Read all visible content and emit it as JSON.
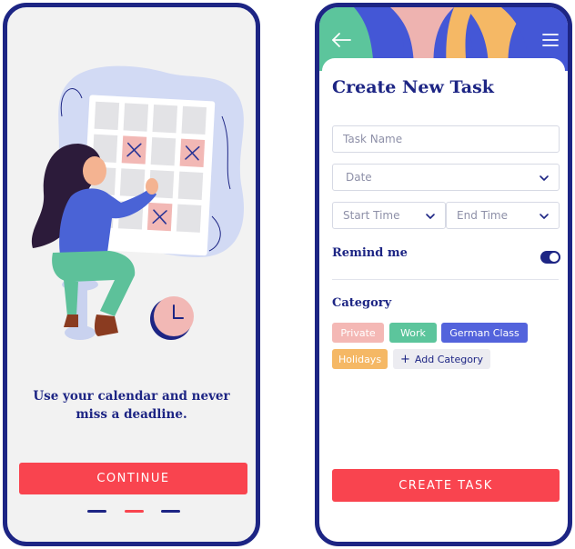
{
  "onboarding": {
    "line1": "Use your calendar and never",
    "line2": "miss a deadline.",
    "continue_label": "CONTINUE",
    "pages": {
      "current": 2,
      "total": 3
    },
    "colors": {
      "brand": "#1d2584",
      "accent": "#f9444f",
      "dot_inactive": "#1d2584",
      "dot_active": "#f9444f"
    }
  },
  "create_task": {
    "header": {
      "back_icon": "arrow-left-icon",
      "menu_icon": "hamburger-menu-icon"
    },
    "title": "Create New Task",
    "task_name_placeholder": "Task Name",
    "date_label": "Date",
    "start_time_label": "Start Time",
    "end_time_label": "End Time",
    "remind_label": "Remind me",
    "remind_on": true,
    "category_label": "Category",
    "categories": [
      {
        "label": "Private",
        "color": "#f4b8b5"
      },
      {
        "label": "Work",
        "color": "#5cc59c"
      },
      {
        "label": "German Class",
        "color": "#5363dc"
      },
      {
        "label": "Holidays",
        "color": "#f5b865"
      }
    ],
    "add_category_label": "Add Category",
    "create_label": "CREATE TASK"
  }
}
